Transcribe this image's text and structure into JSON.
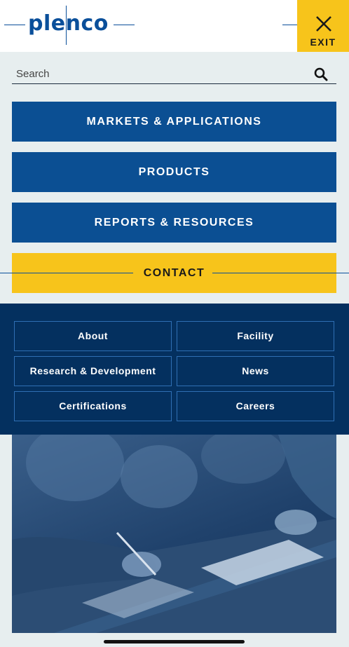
{
  "brand": {
    "logo_text": "plenco"
  },
  "header": {
    "exit_label": "EXIT"
  },
  "search": {
    "placeholder": "Search",
    "value": ""
  },
  "nav": {
    "main": [
      {
        "label": "MARKETS & APPLICATIONS"
      },
      {
        "label": "PRODUCTS"
      },
      {
        "label": "REPORTS & RESOURCES"
      },
      {
        "label": "CONTACT"
      }
    ],
    "secondary": [
      {
        "label": "About"
      },
      {
        "label": "Facility"
      },
      {
        "label": "Research & Development"
      },
      {
        "label": "News"
      },
      {
        "label": "Certifications"
      },
      {
        "label": "Careers"
      }
    ]
  },
  "colors": {
    "brand_blue": "#0b4f93",
    "navy": "#04305f",
    "accent_yellow": "#f7c41b",
    "background": "#e7eeef"
  },
  "icons": {
    "exit": "close-icon",
    "search": "search-icon"
  }
}
